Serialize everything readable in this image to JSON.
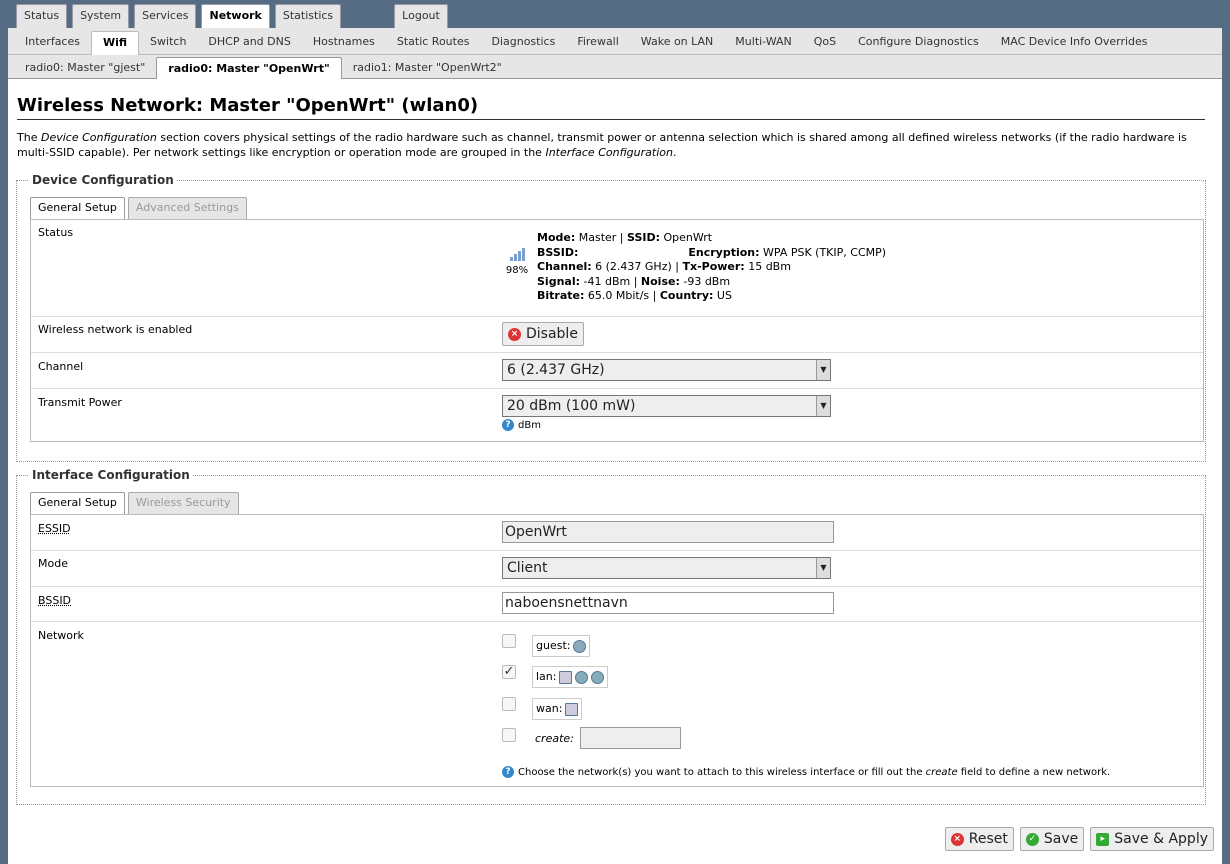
{
  "topmenu": [
    {
      "label": "Status",
      "active": false
    },
    {
      "label": "System",
      "active": false
    },
    {
      "label": "Services",
      "active": false
    },
    {
      "label": "Network",
      "active": true
    },
    {
      "label": "Statistics",
      "active": false
    }
  ],
  "logout": "Logout",
  "submenu": [
    {
      "label": "Interfaces"
    },
    {
      "label": "Wifi",
      "active": true
    },
    {
      "label": "Switch"
    },
    {
      "label": "DHCP and DNS"
    },
    {
      "label": "Hostnames"
    },
    {
      "label": "Static Routes"
    },
    {
      "label": "Diagnostics"
    },
    {
      "label": "Firewall"
    },
    {
      "label": "Wake on LAN"
    },
    {
      "label": "Multi-WAN"
    },
    {
      "label": "QoS"
    },
    {
      "label": "Configure Diagnostics"
    },
    {
      "label": "MAC Device Info Overrides"
    }
  ],
  "radiotabs": [
    {
      "label": "radio0: Master \"gjest\""
    },
    {
      "label": "radio0: Master \"OpenWrt\"",
      "active": true
    },
    {
      "label": "radio1: Master \"OpenWrt2\""
    }
  ],
  "page_title": "Wireless Network: Master \"OpenWrt\" (wlan0)",
  "description": {
    "p1": "The ",
    "em1": "Device Configuration",
    "p2": " section covers physical settings of the radio hardware such as channel, transmit power or antenna selection which is shared among all defined wireless networks (if the radio hardware is multi-SSID capable). Per network settings like encryption or operation mode are grouped in the ",
    "em2": "Interface Configuration",
    "p3": "."
  },
  "device": {
    "legend": "Device Configuration",
    "tabs": [
      "General Setup",
      "Advanced Settings"
    ],
    "status_label": "Status",
    "signal_percent": "98%",
    "status": {
      "mode_k": "Mode:",
      "mode_v": " Master | ",
      "ssid_k": "SSID:",
      "ssid_v": " OpenWrt",
      "bssid_k": "BSSID:",
      "enc_k": "Encryption:",
      "enc_v": " WPA PSK (TKIP, CCMP)",
      "chan_k": "Channel:",
      "chan_v": " 6 (2.437 GHz) | ",
      "txp_k": "Tx-Power:",
      "txp_v": " 15 dBm",
      "sig_k": "Signal:",
      "sig_v": " -41 dBm | ",
      "noise_k": "Noise:",
      "noise_v": " -93 dBm",
      "rate_k": "Bitrate:",
      "rate_v": " 65.0 Mbit/s | ",
      "country_k": "Country:",
      "country_v": " US"
    },
    "enabled_label": "Wireless network is enabled",
    "disable_btn": "Disable",
    "channel_label": "Channel",
    "channel_value": "6 (2.437 GHz)",
    "txpower_label": "Transmit Power",
    "txpower_value": "20 dBm (100 mW)",
    "txpower_help": "dBm"
  },
  "iface": {
    "legend": "Interface Configuration",
    "tabs": [
      "General Setup",
      "Wireless Security"
    ],
    "essid_label": "ESSID",
    "essid_value": "OpenWrt",
    "mode_label": "Mode",
    "mode_value": "Client",
    "bssid_label": "BSSID",
    "bssid_value": "naboensnettnavn",
    "network_label": "Network",
    "networks": [
      {
        "name": "guest:",
        "checked": false
      },
      {
        "name": "lan:",
        "checked": true
      },
      {
        "name": "wan:",
        "checked": false
      }
    ],
    "create_label": "create:",
    "help_p1": "Choose the network(s) you want to attach to this wireless interface or fill out the ",
    "help_em": "create",
    "help_p2": " field to define a new network."
  },
  "buttons": {
    "reset": "Reset",
    "save": "Save",
    "apply": "Save & Apply"
  }
}
